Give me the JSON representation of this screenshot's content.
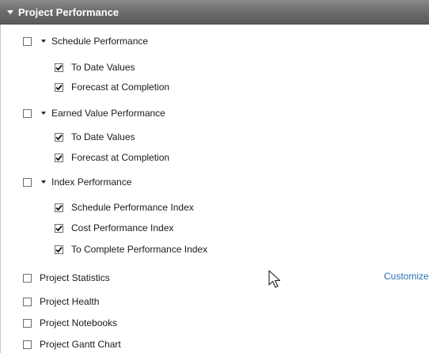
{
  "panel": {
    "title": "Project Performance"
  },
  "groups": [
    {
      "label": "Schedule Performance",
      "checked": false,
      "items": [
        {
          "label": "To Date Values",
          "checked": true
        },
        {
          "label": "Forecast at Completion",
          "checked": true
        }
      ]
    },
    {
      "label": "Earned Value Performance",
      "checked": false,
      "items": [
        {
          "label": "To Date Values",
          "checked": true
        },
        {
          "label": "Forecast at Completion",
          "checked": true
        }
      ]
    },
    {
      "label": "Index Performance",
      "checked": false,
      "items": [
        {
          "label": "Schedule Performance Index",
          "checked": true
        },
        {
          "label": "Cost Performance Index",
          "checked": true
        },
        {
          "label": "To Complete Performance Index",
          "checked": true
        }
      ]
    }
  ],
  "options": [
    {
      "label": "Project Statistics",
      "checked": false
    },
    {
      "label": "Project Health",
      "checked": false
    },
    {
      "label": "Project Notebooks",
      "checked": false
    },
    {
      "label": "Project Gantt Chart",
      "checked": false
    }
  ],
  "customize_label": "Customize"
}
